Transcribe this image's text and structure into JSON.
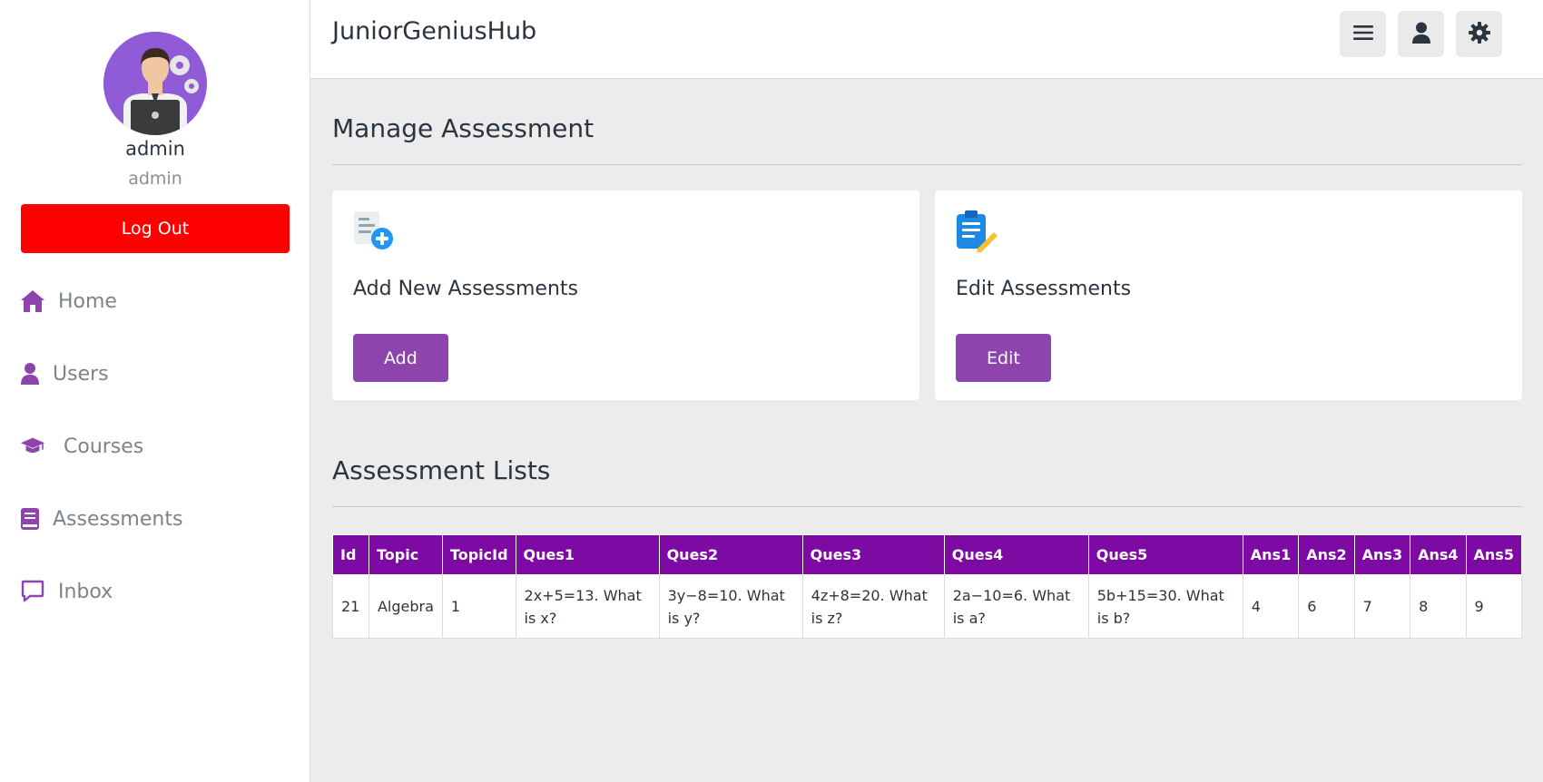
{
  "app": {
    "brand": "JuniorGeniusHub"
  },
  "profile": {
    "name": "admin",
    "role": "admin",
    "logout_label": "Log Out"
  },
  "sidebar": {
    "items": [
      {
        "label": "Home",
        "icon": "home-icon"
      },
      {
        "label": "Users",
        "icon": "user-icon"
      },
      {
        "label": "Courses",
        "icon": "graduation-cap-icon"
      },
      {
        "label": "Assessments",
        "icon": "book-icon"
      },
      {
        "label": "Inbox",
        "icon": "chat-icon"
      }
    ]
  },
  "header": {
    "buttons": [
      "menu-icon",
      "user-icon",
      "gear-icon"
    ]
  },
  "manage": {
    "title": "Manage Assessment",
    "cards": [
      {
        "title": "Add New Assessments",
        "button": "Add",
        "icon": "add-document-icon"
      },
      {
        "title": "Edit Assessments",
        "button": "Edit",
        "icon": "edit-clipboard-icon"
      }
    ]
  },
  "list": {
    "title": "Assessment Lists",
    "columns": [
      "Id",
      "Topic",
      "TopicId",
      "Ques1",
      "Ques2",
      "Ques3",
      "Ques4",
      "Ques5",
      "Ans1",
      "Ans2",
      "Ans3",
      "Ans4",
      "Ans5"
    ],
    "rows": [
      [
        "21",
        "Algebra",
        "1",
        "2x+5=13. What is x?",
        "3y−8=10. What is y?",
        "4z+8=20. What is z?",
        "2a−10=6. What is a?",
        "5b+15=30. What is b?",
        "4",
        "6",
        "7",
        "8",
        "9"
      ]
    ]
  },
  "colors": {
    "accent": "#8e44ad",
    "table_header": "#7e0aa4",
    "logout": "#ff0000",
    "nav_icon": "#8e44ad"
  }
}
